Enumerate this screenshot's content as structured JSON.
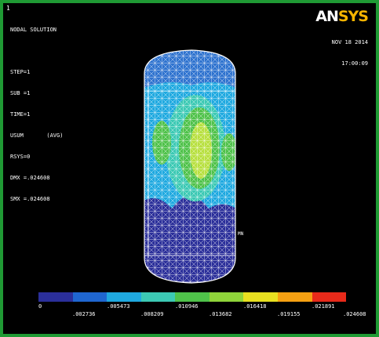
{
  "window_number": "1",
  "info_lines": [
    "NODAL SOLUTION",
    "",
    "STEP=1",
    "SUB =1",
    "TIME=1",
    "USUM       (AVG)",
    "RSYS=0",
    "DMX =.024608",
    "SMX =.024608"
  ],
  "logo": {
    "main": "AN",
    "accent": "SYS"
  },
  "date": "NOV 18 2014",
  "time": "17:00:09",
  "colors": {
    "frame": "#1f9a34",
    "background": "#000000",
    "accent": "#f5b400"
  },
  "legend": {
    "colors": [
      "#2b2f9a",
      "#1f66d0",
      "#1fa9e0",
      "#3cc9b4",
      "#4fc24a",
      "#8fd43a",
      "#e8e020",
      "#f5a012",
      "#e82a1a"
    ],
    "top_labels": [
      "0",
      ".005473",
      ".010946",
      ".016418",
      ".021891"
    ],
    "bottom_labels": [
      ".002736",
      ".008209",
      ".013682",
      ".019155",
      ".024608"
    ]
  },
  "node_marker": "MN"
}
